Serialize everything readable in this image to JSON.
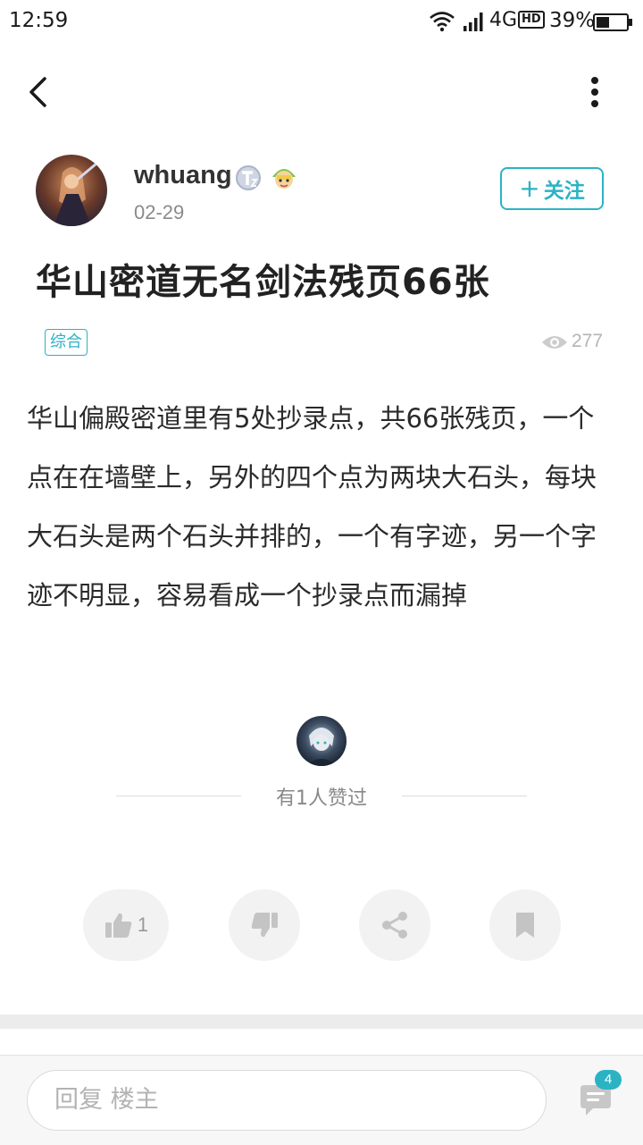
{
  "status_bar": {
    "time": "12:59",
    "network": "4G",
    "hd": "HD",
    "battery": "39%"
  },
  "header": {
    "back_icon": "chevron-left-icon",
    "more_icon": "more-vertical-icon"
  },
  "author": {
    "name": "whuang",
    "date": "02-29",
    "follow_label": "关注",
    "follow_plus": "+"
  },
  "post": {
    "title": "华山密道无名剑法残页66张",
    "tag": "综合",
    "views": "277",
    "body": "华山偏殿密道里有5处抄录点，共66张残页，一个点在在墙壁上，另外的四个点为两块大石头，每块大石头是两个石头并排的，一个有字迹，另一个字迹不明显，容易看成一个抄录点而漏掉"
  },
  "likers": {
    "text": "有1人赞过"
  },
  "actions": {
    "like_count": "1"
  },
  "reply": {
    "placeholder": "回复  楼主",
    "comment_count": "4"
  },
  "colors": {
    "accent": "#2bb3c4",
    "text": "#222222",
    "muted": "#8a8a8a"
  }
}
